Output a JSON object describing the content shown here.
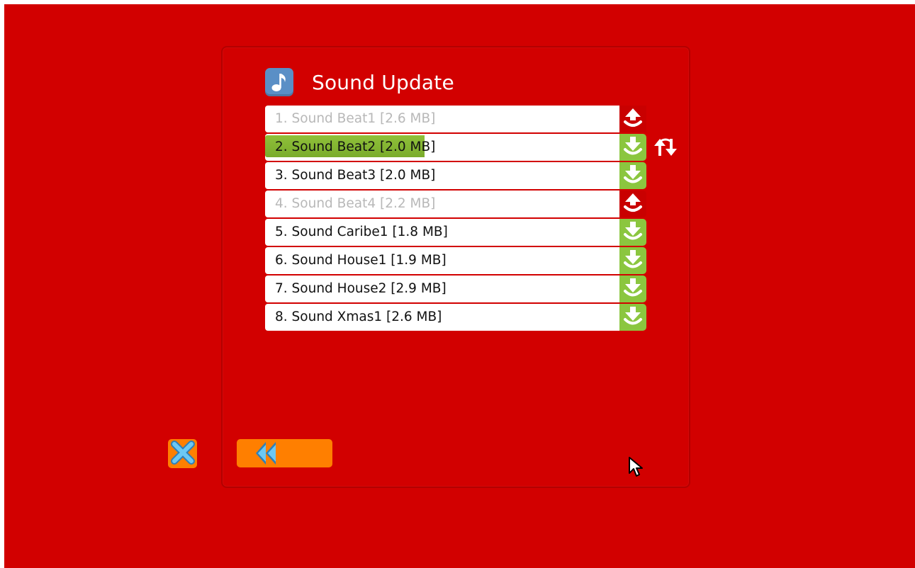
{
  "header": {
    "title": "Sound Update",
    "icon": "music-note-icon"
  },
  "colors": {
    "background": "#d20000",
    "download": "#8bc63f",
    "upload": "#c90000",
    "progress": "#7aac2b",
    "button": "#ff7f00",
    "button_icon": "#5fc0f0"
  },
  "sounds": [
    {
      "label": "1. Sound Beat1 [2.6 MB]",
      "status": "installed",
      "action": "upload-icon"
    },
    {
      "label": "2. Sound Beat2 [2.0 MB]",
      "status": "downloading",
      "progress": 0.45,
      "action": "download-icon",
      "sync": "sync-icon"
    },
    {
      "label": "3. Sound Beat3 [2.0 MB]",
      "status": "available",
      "action": "download-icon"
    },
    {
      "label": "4. Sound Beat4 [2.2 MB]",
      "status": "installed",
      "action": "upload-icon"
    },
    {
      "label": "5. Sound Caribe1 [1.8 MB]",
      "status": "available",
      "action": "download-icon"
    },
    {
      "label": "6. Sound House1 [1.9 MB]",
      "status": "available",
      "action": "download-icon"
    },
    {
      "label": "7. Sound House2 [2.9 MB]",
      "status": "available",
      "action": "download-icon"
    },
    {
      "label": "8. Sound Xmas1 [2.6 MB]",
      "status": "available",
      "action": "download-icon"
    }
  ],
  "footer": {
    "close_icon": "close-x-icon",
    "back_icon": "rewind-icon"
  }
}
